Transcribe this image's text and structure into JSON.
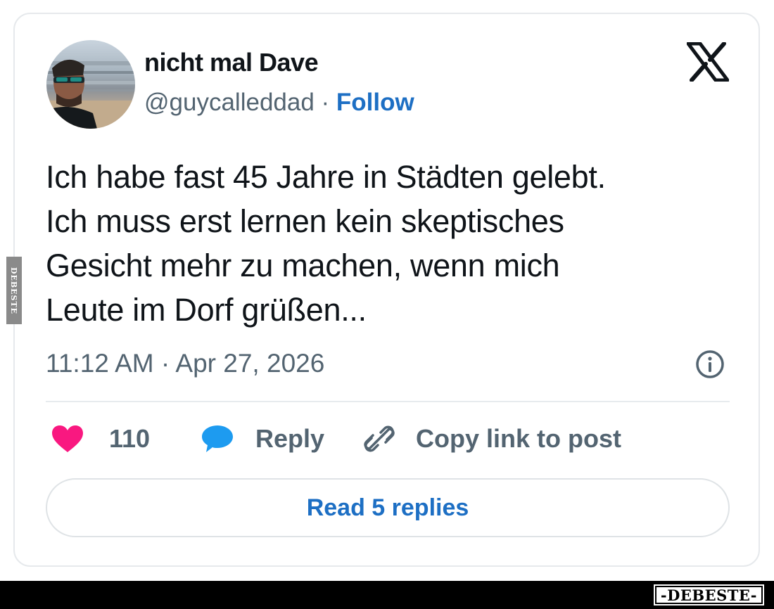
{
  "tweet": {
    "author_name": "nicht mal Dave",
    "handle": "@guycalleddad",
    "separator": " · ",
    "follow_label": "Follow",
    "text_lines": [
      "Ich habe fast 45 Jahre in Städten gelebt.",
      "Ich muss erst lernen kein skeptisches",
      "Gesicht mehr zu machen, wenn mich",
      "Leute im Dorf grüßen..."
    ],
    "timestamp": "11:12 AM · Apr 27, 2026"
  },
  "actions": {
    "like_count": "110",
    "reply_label": "Reply",
    "copy_label": "Copy link to post"
  },
  "read_replies_label": "Read 5 replies",
  "watermark": {
    "side_text": "DEBESTE",
    "bottom_text": "-DEBESTE-"
  },
  "icons": {
    "brand": "x-logo-icon",
    "info": "info-icon",
    "like": "heart-icon",
    "reply": "speech-bubble-icon",
    "copy": "link-icon"
  },
  "colors": {
    "like": "#f91880",
    "reply": "#1d9bf0",
    "link_blue": "#1d6fc4",
    "secondary_text": "#536471"
  }
}
